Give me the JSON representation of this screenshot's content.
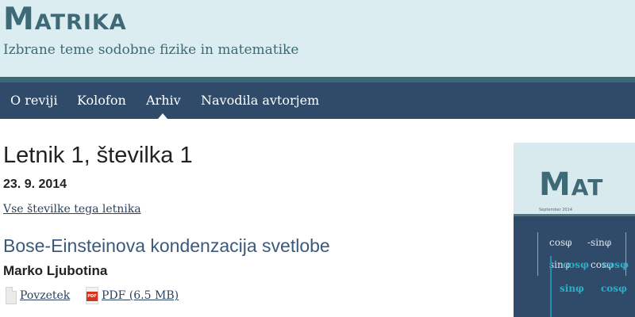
{
  "header": {
    "logo": "Matrika",
    "tagline": "Izbrane teme sodobne fizike in matematike"
  },
  "nav": {
    "items": [
      {
        "label": "O reviji"
      },
      {
        "label": "Kolofon"
      },
      {
        "label": "Arhiv",
        "active": true
      },
      {
        "label": "Navodila avtorjem"
      }
    ]
  },
  "issue": {
    "title": "Letnik 1, številka 1",
    "date": "23. 9. 2014",
    "all_issues_link": "Vse številke tega letnika"
  },
  "article": {
    "title": "Bose-Einsteinova kondenzacija svetlobe",
    "author": "Marko Ljubotina",
    "galleys": [
      {
        "label": "Povzetek",
        "icon": "document-icon"
      },
      {
        "label": "PDF (6.5 MB)",
        "icon": "pdf-icon",
        "icon_text": "PDF"
      }
    ]
  },
  "cover": {
    "logo": "Mat",
    "date": "September 2014",
    "matrix": {
      "cells": [
        "cosφ",
        "-sinφ",
        "sinφ",
        "cosφ"
      ],
      "overlay": [
        "cosφ",
        "cosφ",
        "sinφ",
        "cosφ"
      ]
    }
  },
  "colors": {
    "header_bg": "#dcedf1",
    "brand": "#3e6976",
    "nav_bg": "#304b6a",
    "link": "#2b4160",
    "article_title": "#3a5a7c"
  }
}
